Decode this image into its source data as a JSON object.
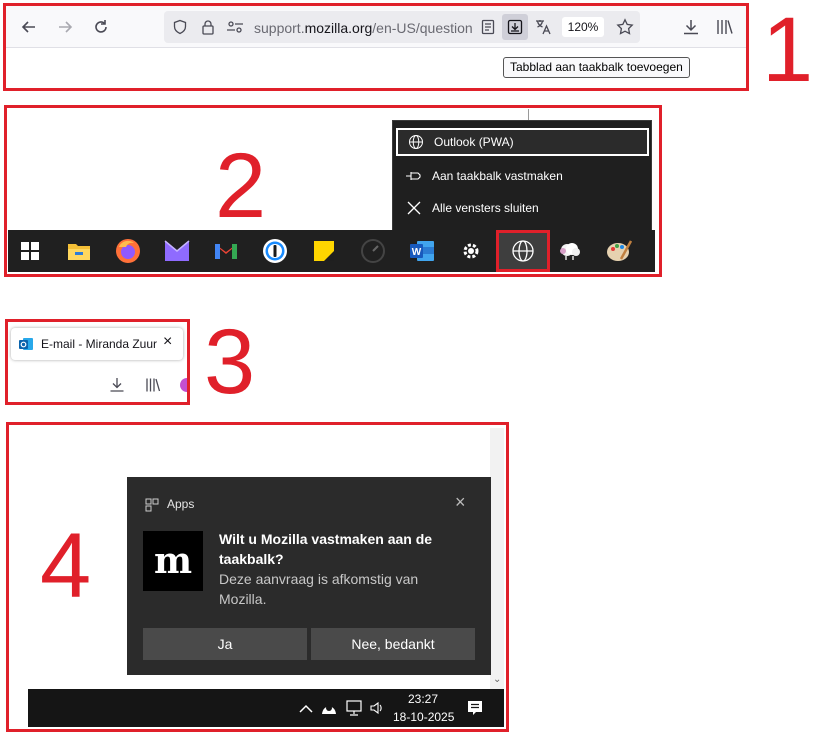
{
  "annotations": {
    "panel1": "1",
    "panel2": "2",
    "panel3": "3",
    "panel4": "4"
  },
  "colors": {
    "annotation_red": "#e0202a",
    "taskbar_bg": "#202020",
    "notification_bg": "#2b2b2b",
    "toolbar_bg": "#f9f9fb"
  },
  "browser": {
    "url_prefix": "support.",
    "url_domain": "mozilla.org",
    "url_path": "/en-US/question",
    "zoom": "120%",
    "tooltip": "Tabblad aan taakbalk toevoegen",
    "icons": [
      "back-arrow-icon",
      "forward-arrow-icon",
      "reload-icon",
      "shield-icon",
      "lock-icon",
      "permissions-icon",
      "reader-view-icon",
      "install-tab-icon",
      "translate-icon",
      "bookmark-star-icon",
      "download-icon",
      "library-icon"
    ]
  },
  "jumplist": {
    "items": [
      {
        "label": "Outlook (PWA)",
        "icon": "globe-icon"
      },
      {
        "label": "Aan taakbalk vastmaken",
        "icon": "pin-icon"
      },
      {
        "label": "Alle vensters sluiten",
        "icon": "close-icon"
      }
    ]
  },
  "taskbar": {
    "icons": [
      "windows-start-icon",
      "file-explorer-icon",
      "firefox-icon",
      "proton-mail-icon",
      "gmail-icon",
      "onepassword-icon",
      "sticky-notes-icon",
      "speedometer-icon",
      "word-icon",
      "settings-gear-icon",
      "globe-pwa-icon",
      "sheep-app-icon",
      "paint-palette-icon"
    ]
  },
  "tab": {
    "title": "E-mail - Miranda Zuurl",
    "close": "×",
    "icons": [
      "outlook-icon",
      "download-icon",
      "library-icon",
      "extension-icon"
    ]
  },
  "notification": {
    "app_label": "Apps",
    "close": "×",
    "logo_letter": "m",
    "title": "Wilt u Mozilla vastmaken aan de taakbalk?",
    "body": "Deze aanvraag is afkomstig van Mozilla.",
    "accept": "Ja",
    "decline": "Nee, bedankt"
  },
  "tray": {
    "time": "23:27",
    "date": "18-10-2025",
    "icons": [
      "chevron-up-icon",
      "app-tray-icon",
      "network-icon",
      "volume-icon",
      "notification-center-icon"
    ]
  }
}
